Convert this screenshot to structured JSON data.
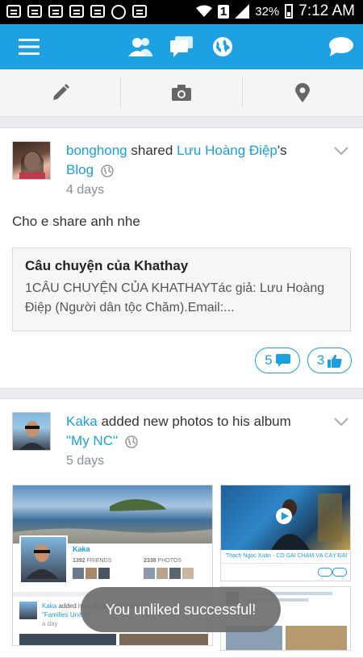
{
  "status_bar": {
    "battery": "32%",
    "time": "7:12 AM",
    "sim_indicator": "1"
  },
  "top_nav": {
    "icons": [
      "menu-icon",
      "friends-icon",
      "messages-icon",
      "globe-icon",
      "chat-bubble-icon"
    ]
  },
  "composer": {
    "icons": [
      "pencil-icon",
      "camera-icon",
      "location-pin-icon"
    ]
  },
  "posts": [
    {
      "author": "bonghong",
      "action": " shared ",
      "target_owner": "Lưu Hoàng Điệp",
      "possessive": "'s",
      "object": "Blog",
      "time": "4 days",
      "text": "Cho e share anh nhe",
      "attachment_title": "Câu chuyện của Khathay",
      "attachment_desc": "1CÂU CHUYỆN CỦA KHATHAYTác giả: Lưu Hoàng Điệp (Người dân tộc Chăm).Email:...",
      "comments": "5",
      "likes": "3"
    },
    {
      "author": "Kaka",
      "action": " added new photos to his album ",
      "album": "\"My NC\"",
      "time": "5 days",
      "thumb_profile_name": "Kaka",
      "thumb_friends_count": "1392",
      "thumb_friends_label": "FRIENDS",
      "thumb_photos_count": "2338",
      "thumb_photos_label": "PHOTOS",
      "thumb_caption": "Thạch Ngọc Xuân - CÔ GÁI CHĂM VÀ CÂY ĐÀN ...",
      "thumb_sub_name": "Kaka",
      "thumb_sub_action": " added new photos to his album",
      "thumb_sub_album": "\"Families United\"",
      "thumb_sub_time": "a day"
    }
  ],
  "toast": "You unliked successful!",
  "colors": {
    "brand": "#1ea1e3",
    "link": "#1a9fdf"
  }
}
